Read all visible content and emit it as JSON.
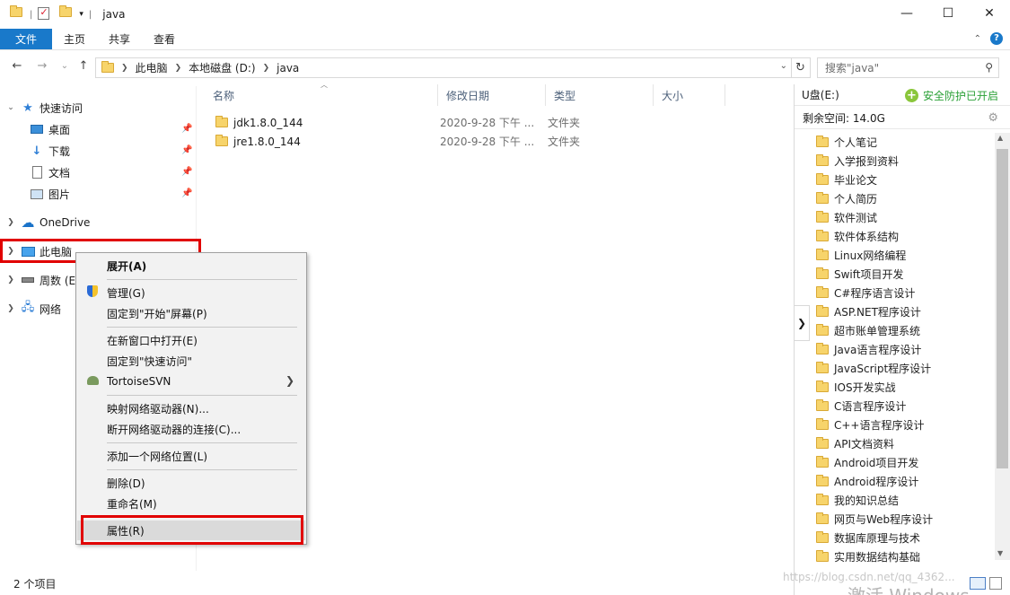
{
  "window": {
    "title": "java",
    "minimize": "—",
    "maximize": "☐",
    "close": "✕"
  },
  "ribbon": {
    "tabs": [
      "文件",
      "主页",
      "共享",
      "查看"
    ]
  },
  "nav": {
    "back": "←",
    "forward": "→",
    "recent": "⌄",
    "up": "↑",
    "breadcrumb": [
      "此电脑",
      "本地磁盘 (D:)",
      "java"
    ],
    "search_placeholder": "搜索\"java\""
  },
  "sidebar": {
    "quick_access": "快速访问",
    "quick_items": [
      "桌面",
      "下载",
      "文档",
      "图片"
    ],
    "onedrive": "OneDrive",
    "this_pc": "此电脑",
    "zhoushu": "周数 (E",
    "network": "网络"
  },
  "columns": {
    "name": "名称",
    "modified": "修改日期",
    "type": "类型",
    "size": "大小"
  },
  "files": [
    {
      "name": "jdk1.8.0_144",
      "modified": "2020-9-28 下午 ...",
      "type": "文件夹"
    },
    {
      "name": "jre1.8.0_144",
      "modified": "2020-9-28 下午 ...",
      "type": "文件夹"
    }
  ],
  "status": {
    "count": "2 个项目"
  },
  "panel": {
    "drive": "U盘(E:)",
    "protect": "安全防护已开启",
    "space_label": "剩余空间: 14.0G",
    "folders": [
      "个人笔记",
      "入学报到资料",
      "毕业论文",
      "个人简历",
      "软件测试",
      "软件体系结构",
      "Linux网络编程",
      "Swift项目开发",
      "C#程序语言设计",
      "ASP.NET程序设计",
      "超市账单管理系统",
      "Java语言程序设计",
      "JavaScript程序设计",
      "IOS开发实战",
      "C语言程序设计",
      "C++语言程序设计",
      "API文档资料",
      "Android项目开发",
      "Android程序设计",
      "我的知识总结",
      "网页与Web程序设计",
      "数据库原理与技术",
      "实用数据结构基础"
    ]
  },
  "context_menu": {
    "expand": "展开(A)",
    "manage": "管理(G)",
    "pin_start": "固定到\"开始\"屏幕(P)",
    "open_new": "在新窗口中打开(E)",
    "pin_quick": "固定到\"快速访问\"",
    "tortoise": "TortoiseSVN",
    "map_drive": "映射网络驱动器(N)...",
    "disconnect": "断开网络驱动器的连接(C)...",
    "add_location": "添加一个网络位置(L)",
    "delete": "删除(D)",
    "rename": "重命名(M)",
    "properties": "属性(R)"
  },
  "watermark": {
    "blog": "https://blog.csdn.net/qq_4362...",
    "activate": "激活 Windows"
  },
  "colors": {
    "accent": "#1979ca",
    "highlight_box": "#e10000",
    "protect_green": "#2aa036"
  }
}
